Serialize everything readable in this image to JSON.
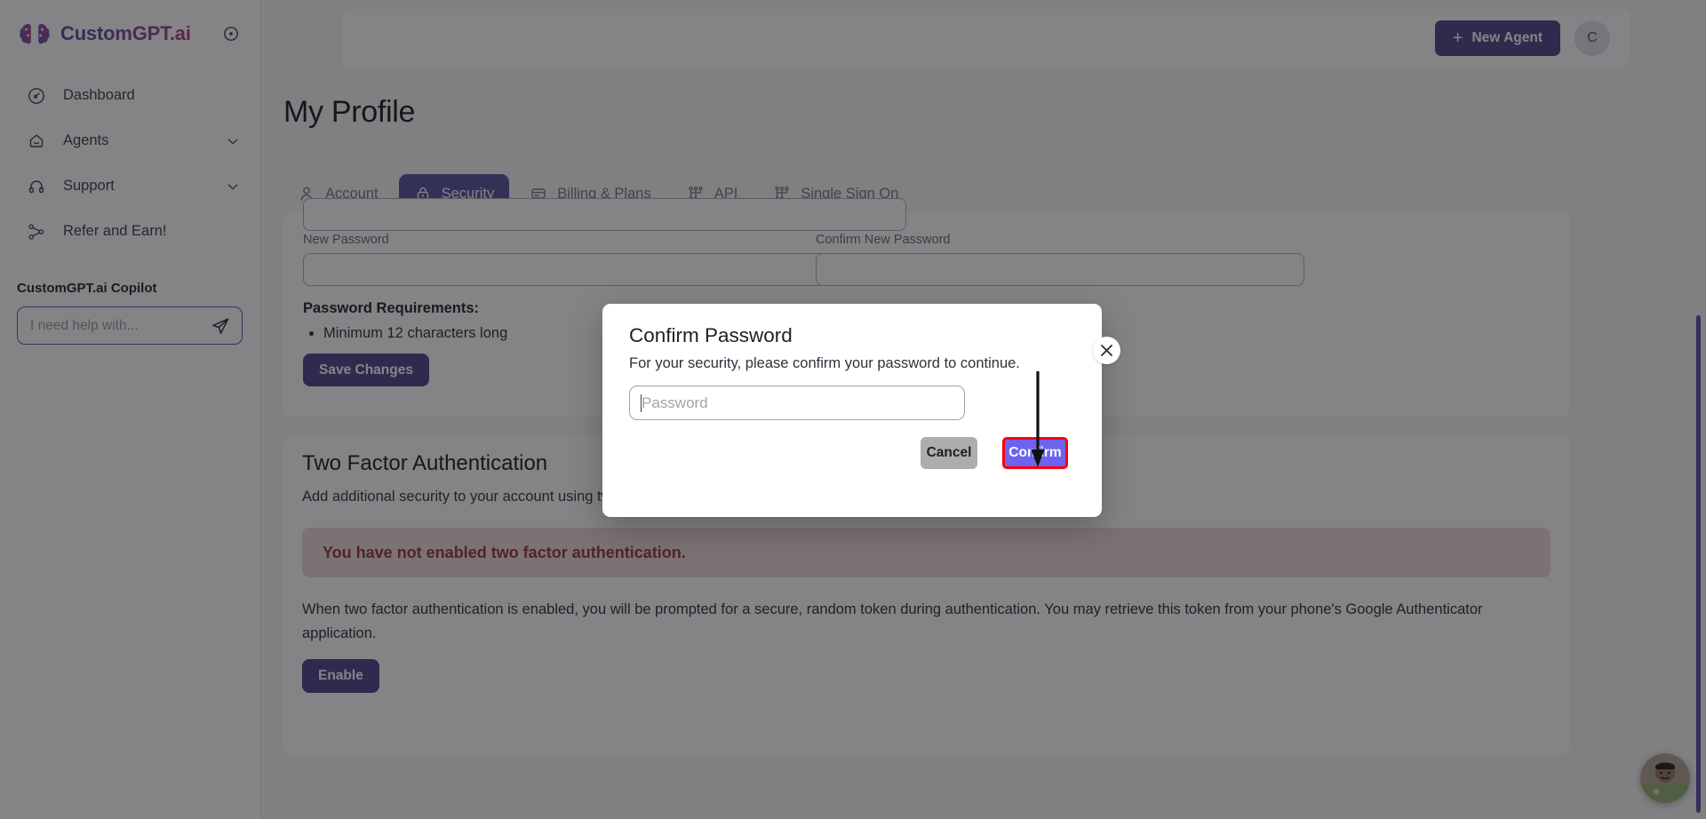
{
  "brand": {
    "name": "CustomGPT.ai",
    "logo_icon": "brain-logo-icon",
    "collapse_icon": "circle-dot-collapse-icon"
  },
  "sidebar": {
    "items": [
      {
        "label": "Dashboard",
        "icon": "gauge-icon",
        "caret": false
      },
      {
        "label": "Agents",
        "icon": "bot-icon",
        "caret": true
      },
      {
        "label": "Support",
        "icon": "headset-icon",
        "caret": true
      },
      {
        "label": "Refer and Earn!",
        "icon": "share-nodes-icon",
        "caret": false
      }
    ],
    "copilot": {
      "title": "CustomGPT.ai Copilot",
      "placeholder": "I need help with...",
      "value": "",
      "send_icon": "send-paper-plane-icon"
    }
  },
  "header": {
    "new_agent_label": "New Agent",
    "new_agent_icon": "plus-icon",
    "avatar_initial": "C"
  },
  "page": {
    "title": "My Profile"
  },
  "tabs": [
    {
      "label": "Account",
      "icon": "user-icon",
      "active": false
    },
    {
      "label": "Security",
      "icon": "lock-icon",
      "active": true
    },
    {
      "label": "Billing & Plans",
      "icon": "credit-card-icon",
      "active": false
    },
    {
      "label": "API",
      "icon": "network-nodes-icon",
      "active": false
    },
    {
      "label": "Single Sign On",
      "icon": "network-nodes-icon",
      "active": false
    }
  ],
  "password_card": {
    "new_password_label": "New Password",
    "confirm_password_label": "Confirm New Password",
    "new_password_value": "",
    "confirm_password_value": "",
    "requirements_title": "Password Requirements:",
    "requirements": [
      "Minimum 12 characters long"
    ],
    "save_label": "Save Changes"
  },
  "two_factor": {
    "title": "Two Factor Authentication",
    "subtitle": "Add additional security to your account using two factor authentication.",
    "alert": "You have not enabled two factor authentication.",
    "description": "When two factor authentication is enabled, you will be prompted for a secure, random token during authentication. You may retrieve this token from your phone's Google Authenticator application.",
    "enable_label": "Enable"
  },
  "modal": {
    "title": "Confirm Password",
    "subtitle": "For your security, please confirm your password to continue.",
    "input_placeholder": "Password",
    "input_value": "",
    "cancel_label": "Cancel",
    "confirm_label": "Confirm",
    "close_icon": "close-x-icon",
    "annotation_icon": "down-arrow-annotation-icon"
  },
  "chat_widget": {
    "icon": "agent-avatar-photo-icon"
  },
  "colors": {
    "brand_purple": "#5b52c9",
    "primary_button": "#4f45b5",
    "confirm_button": "#6c63f2",
    "highlight_border": "#fb0007",
    "danger_text": "#c02f3c",
    "danger_bg": "#f6d6d8",
    "scrollbar": "#5b52c9"
  }
}
